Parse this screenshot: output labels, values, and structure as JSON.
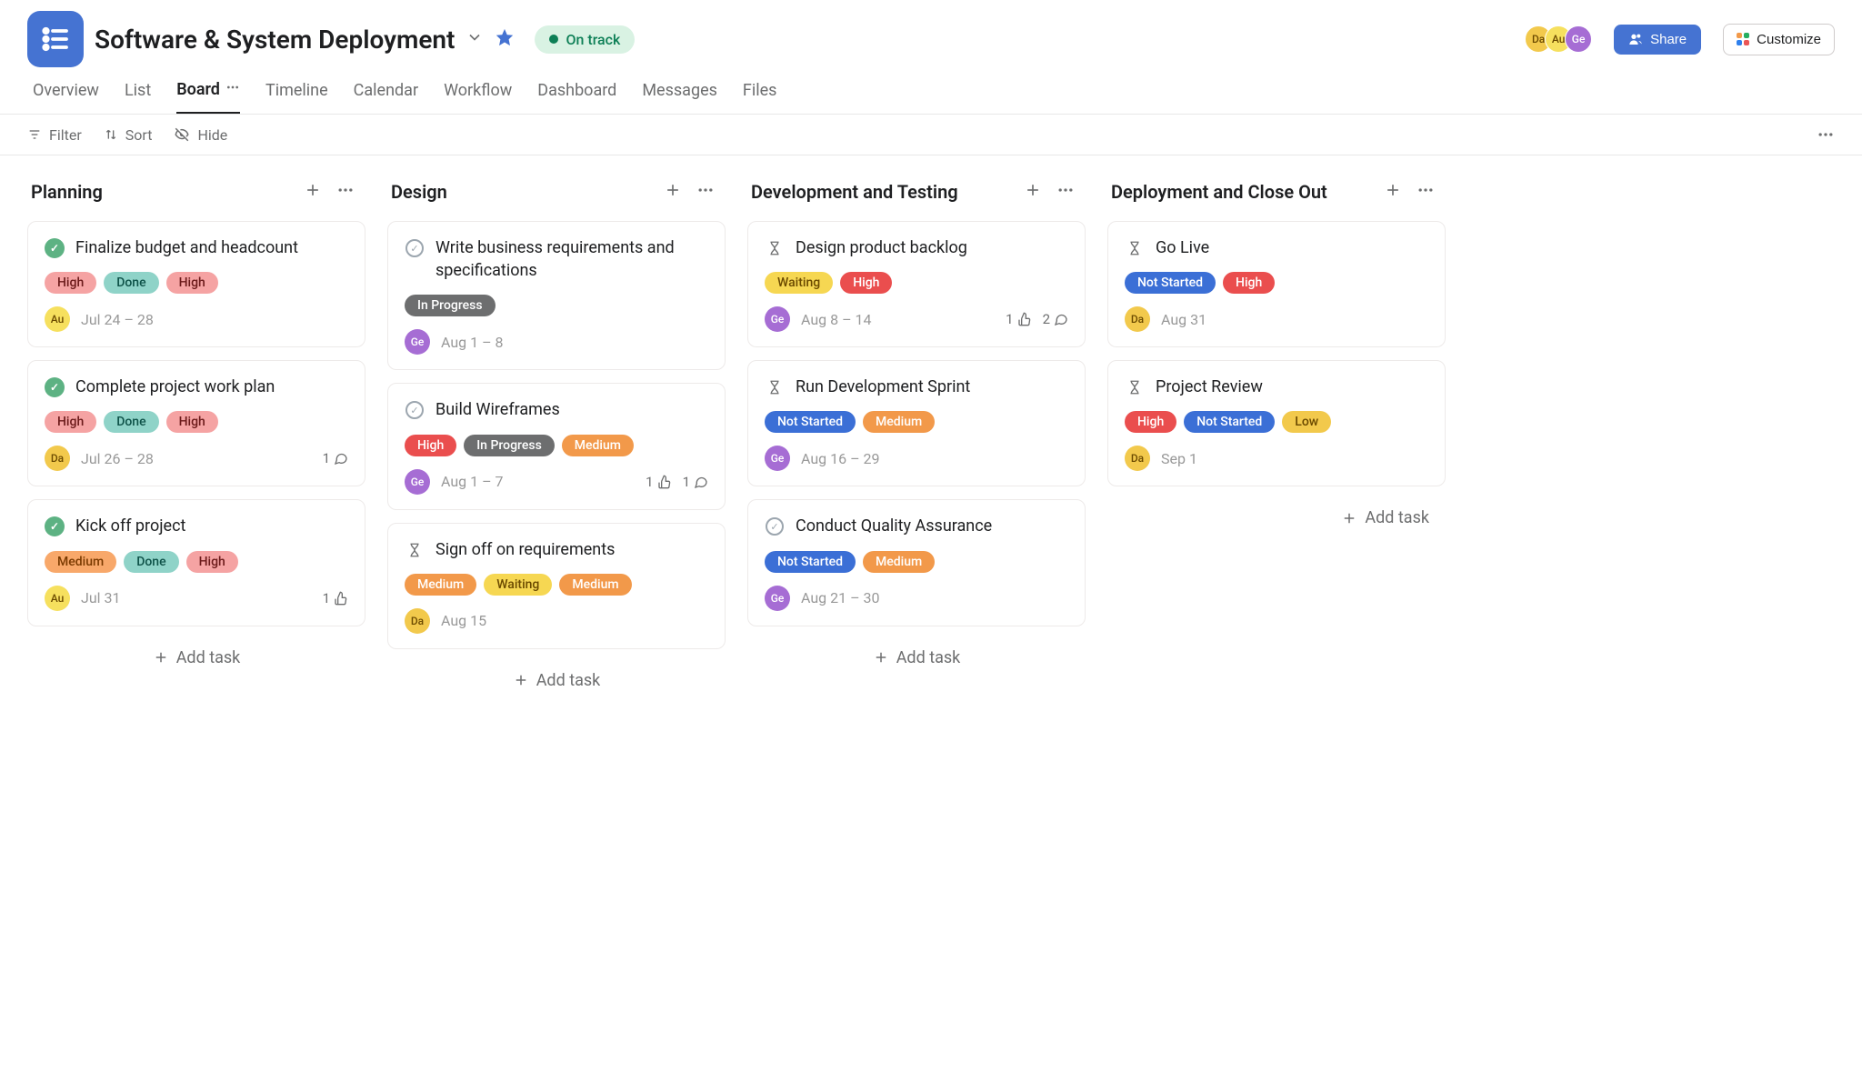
{
  "header": {
    "title": "Software & System Deployment",
    "status": "On track",
    "avatars": [
      "Da",
      "Au",
      "Ge"
    ],
    "share_label": "Share",
    "customize_label": "Customize"
  },
  "tabs": [
    "Overview",
    "List",
    "Board",
    "Timeline",
    "Calendar",
    "Workflow",
    "Dashboard",
    "Messages",
    "Files"
  ],
  "active_tab": "Board",
  "toolbar": {
    "filter": "Filter",
    "sort": "Sort",
    "hide": "Hide"
  },
  "add_task_label": "Add task",
  "columns": [
    {
      "name": "Planning",
      "cards": [
        {
          "icon": "complete",
          "title": "Finalize budget and headcount",
          "tags": [
            {
              "label": "High",
              "cls": "tag-high"
            },
            {
              "label": "Done",
              "cls": "tag-done"
            },
            {
              "label": "High",
              "cls": "tag-high"
            }
          ],
          "assignee": {
            "label": "Au",
            "cls": "av-au"
          },
          "date": "Jul 24 – 28"
        },
        {
          "icon": "complete",
          "title": "Complete project work plan",
          "tags": [
            {
              "label": "High",
              "cls": "tag-high"
            },
            {
              "label": "Done",
              "cls": "tag-done"
            },
            {
              "label": "High",
              "cls": "tag-high"
            }
          ],
          "assignee": {
            "label": "Da",
            "cls": "av-da"
          },
          "date": "Jul 26 – 28",
          "comments": 1
        },
        {
          "icon": "complete",
          "title": "Kick off project",
          "tags": [
            {
              "label": "Medium",
              "cls": "tag-medium-soft"
            },
            {
              "label": "Done",
              "cls": "tag-done"
            },
            {
              "label": "High",
              "cls": "tag-high"
            }
          ],
          "assignee": {
            "label": "Au",
            "cls": "av-au"
          },
          "date": "Jul 31",
          "likes": 1
        }
      ]
    },
    {
      "name": "Design",
      "cards": [
        {
          "icon": "circle",
          "title": "Write business requirements and specifications",
          "tags": [
            {
              "label": "In Progress",
              "cls": "tag-inprog"
            }
          ],
          "assignee": {
            "label": "Ge",
            "cls": "av-ge"
          },
          "date": "Aug 1 – 8"
        },
        {
          "icon": "circle",
          "title": "Build Wireframes",
          "tags": [
            {
              "label": "High",
              "cls": "tag-high-red"
            },
            {
              "label": "In Progress",
              "cls": "tag-inprog"
            },
            {
              "label": "Medium",
              "cls": "tag-medium"
            }
          ],
          "assignee": {
            "label": "Ge",
            "cls": "av-ge"
          },
          "date": "Aug 1 – 7",
          "likes": 1,
          "comments": 1
        },
        {
          "icon": "hourglass",
          "title": "Sign off on requirements",
          "tags": [
            {
              "label": "Medium",
              "cls": "tag-medium"
            },
            {
              "label": "Waiting",
              "cls": "tag-waiting"
            },
            {
              "label": "Medium",
              "cls": "tag-medium"
            }
          ],
          "assignee": {
            "label": "Da",
            "cls": "av-da"
          },
          "date": "Aug 15"
        }
      ]
    },
    {
      "name": "Development and Testing",
      "cards": [
        {
          "icon": "hourglass",
          "title": "Design product backlog",
          "tags": [
            {
              "label": "Waiting",
              "cls": "tag-waiting"
            },
            {
              "label": "High",
              "cls": "tag-high-red"
            }
          ],
          "assignee": {
            "label": "Ge",
            "cls": "av-ge"
          },
          "date": "Aug 8 – 14",
          "likes": 1,
          "comments": 2
        },
        {
          "icon": "hourglass",
          "title": "Run Development Sprint",
          "tags": [
            {
              "label": "Not Started",
              "cls": "tag-notstarted"
            },
            {
              "label": "Medium",
              "cls": "tag-medium"
            }
          ],
          "assignee": {
            "label": "Ge",
            "cls": "av-ge"
          },
          "date": "Aug 16 – 29"
        },
        {
          "icon": "circle",
          "title": "Conduct Quality Assurance",
          "tags": [
            {
              "label": "Not Started",
              "cls": "tag-notstarted"
            },
            {
              "label": "Medium",
              "cls": "tag-medium"
            }
          ],
          "assignee": {
            "label": "Ge",
            "cls": "av-ge"
          },
          "date": "Aug 21 – 30"
        }
      ]
    },
    {
      "name": "Deployment and Close Out",
      "add_task_align": "right",
      "cards": [
        {
          "icon": "hourglass",
          "title": "Go Live",
          "tags": [
            {
              "label": "Not Started",
              "cls": "tag-notstarted"
            },
            {
              "label": "High",
              "cls": "tag-high-red"
            }
          ],
          "assignee": {
            "label": "Da",
            "cls": "av-da"
          },
          "date": "Aug 31"
        },
        {
          "icon": "hourglass",
          "title": "Project Review",
          "tags": [
            {
              "label": "High",
              "cls": "tag-high-red"
            },
            {
              "label": "Not Started",
              "cls": "tag-notstarted"
            },
            {
              "label": "Low",
              "cls": "tag-low"
            }
          ],
          "assignee": {
            "label": "Da",
            "cls": "av-da"
          },
          "date": "Sep 1"
        }
      ]
    }
  ]
}
